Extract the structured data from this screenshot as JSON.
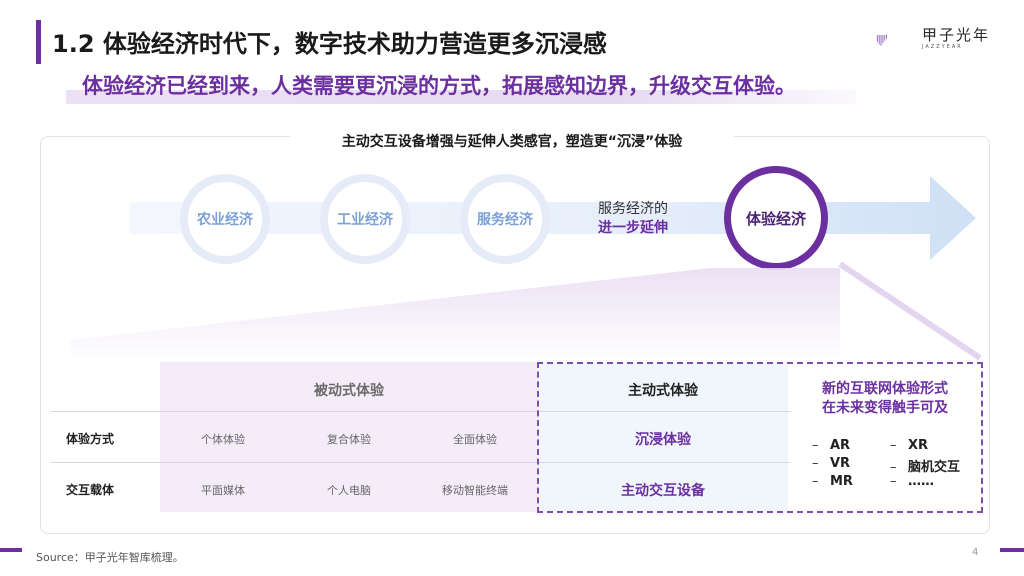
{
  "header": {
    "title": "1.2 体验经济时代下，数字技术助力营造更多沉浸感",
    "subtitle": "体验经济已经到来，人类需要更沉浸的方式，拓展感知边界，升级交互体验。",
    "logo_text": "甲子光年",
    "logo_sub": "JAZZYEAR"
  },
  "flow": {
    "heading": "主动交互设备增强与延伸人类感官，塑造更“沉浸”体验",
    "stages": [
      "农业经济",
      "工业经济",
      "服务经济"
    ],
    "note_line1": "服务经济的",
    "note_line2": "进一步延伸",
    "highlight": "体验经济"
  },
  "table": {
    "passive_header": "被动式体验",
    "active_header": "主动式体验",
    "rows": [
      {
        "label": "体验方式",
        "passive": [
          "个体体验",
          "复合体验",
          "全面体验"
        ],
        "active": "沉浸体验"
      },
      {
        "label": "交互载体",
        "passive": [
          "平面媒体",
          "个人电脑",
          "移动智能终端"
        ],
        "active": "主动交互设备"
      }
    ],
    "future_title_line1": "新的互联网体验形式",
    "future_title_line2": "在未来变得触手可及",
    "future_left": [
      "AR",
      "VR",
      "MR"
    ],
    "future_right": [
      "XR",
      "脑机交互",
      "……"
    ],
    "dash": "–"
  },
  "footer": {
    "source": "Source：甲子光年智库梳理。",
    "page": "4"
  },
  "colors": {
    "accent": "#6b2fa0",
    "light_purple": "#f4edf9",
    "light_blue": "#e5ecf8"
  }
}
